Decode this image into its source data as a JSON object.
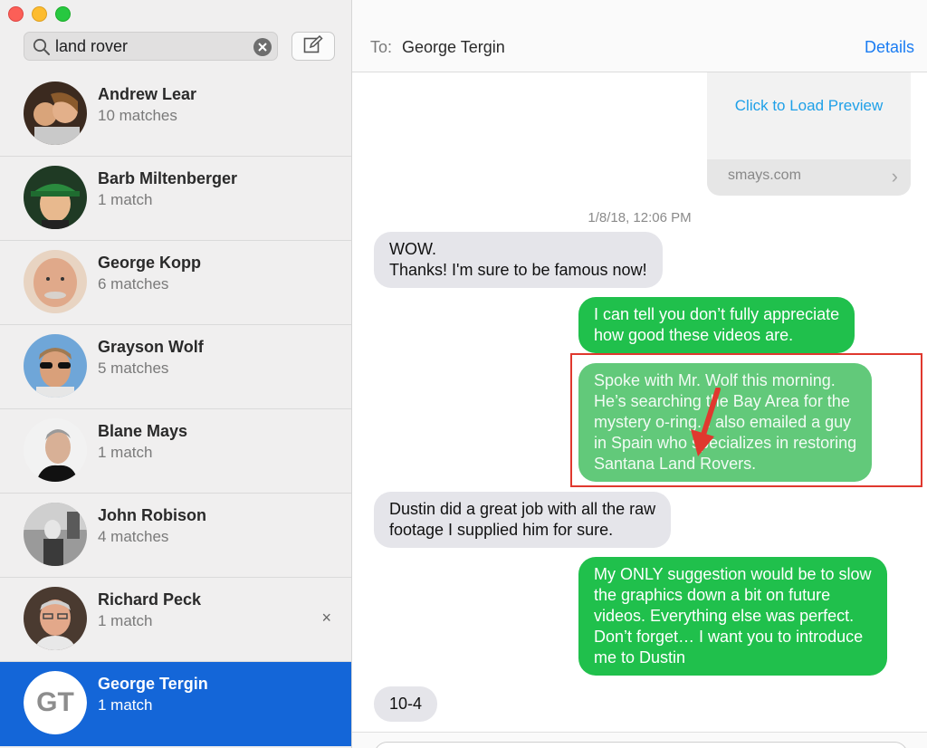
{
  "search": {
    "value": "land rover"
  },
  "conversations": [
    {
      "name": "Andrew Lear",
      "matches": "10 matches"
    },
    {
      "name": "Barb Miltenberger",
      "matches": "1 match"
    },
    {
      "name": "George Kopp",
      "matches": "6 matches"
    },
    {
      "name": "Grayson Wolf",
      "matches": "5 matches"
    },
    {
      "name": "Blane Mays",
      "matches": "1 match"
    },
    {
      "name": "John Robison",
      "matches": "4 matches"
    },
    {
      "name": "Richard Peck",
      "matches": "1 match",
      "remove": "×"
    },
    {
      "name": "George Tergin",
      "matches": "1 match",
      "initials": "GT"
    }
  ],
  "header": {
    "to_label": "To:",
    "recipient": "George Tergin",
    "details": "Details"
  },
  "preview": {
    "link": "Click to Load Preview",
    "domain": "smays.com"
  },
  "timestamp": "1/8/18, 12:06 PM",
  "messages": [
    {
      "direction": "in",
      "lines": [
        "WOW.",
        "Thanks! I'm sure to be famous now!"
      ]
    },
    {
      "direction": "out",
      "lines": [
        "I can tell you don’t fully appreciate",
        "how good these videos are."
      ]
    },
    {
      "direction": "out",
      "lines": [
        "Spoke with Mr. Wolf this morning.",
        "He’s searching the Bay Area for the",
        "mystery o-ring. I also emailed a guy",
        "in Spain who specializes in restoring",
        "Santana Land Rovers."
      ]
    },
    {
      "direction": "in",
      "lines": [
        "Dustin did a great job with all the raw",
        "footage I supplied him for sure."
      ]
    },
    {
      "direction": "out",
      "lines": [
        "My ONLY suggestion would be to slow",
        "the graphics down a bit on future",
        "videos. Everything else was perfect.",
        "Don’t forget… I want you to introduce",
        "me to Dustin"
      ]
    },
    {
      "direction": "in",
      "lines": [
        "10-4"
      ]
    }
  ],
  "colors": {
    "selected": "#1466d8",
    "imessage_green": "#20c04c",
    "link_blue": "#1a7cf2",
    "annotation_red": "#e0382e"
  }
}
